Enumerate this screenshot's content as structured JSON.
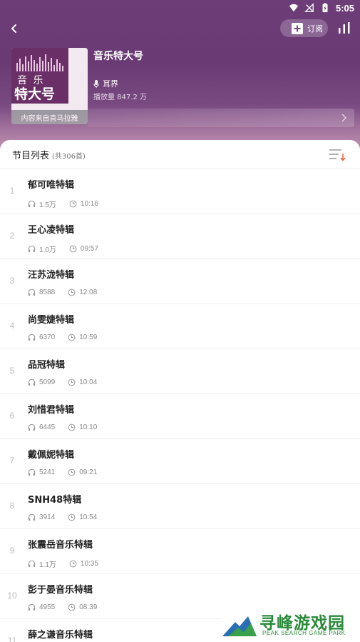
{
  "status_bar": {
    "time": "5:05"
  },
  "header": {
    "subscribe_label": "订阅",
    "cover_line1": "音 乐",
    "cover_line2": "特大号",
    "cover_caption": "内容来自喜马拉雅",
    "album_title": "音乐特大号",
    "host": "耳界",
    "play_count": "播放量 847.2 万"
  },
  "list": {
    "title": "节目列表",
    "count": "(共306首)",
    "tracks": [
      {
        "index": "1",
        "title": "郁可唯特辑",
        "plays": "1.5万",
        "duration": "10:16"
      },
      {
        "index": "2",
        "title": "王心凌特辑",
        "plays": "1.0万",
        "duration": "09:57"
      },
      {
        "index": "3",
        "title": "汪苏泷特辑",
        "plays": "8588",
        "duration": "12:08"
      },
      {
        "index": "4",
        "title": "尚雯婕特辑",
        "plays": "6370",
        "duration": "10:59"
      },
      {
        "index": "5",
        "title": "品冠特辑",
        "plays": "5099",
        "duration": "10:04"
      },
      {
        "index": "6",
        "title": "刘惜君特辑",
        "plays": "6445",
        "duration": "10:10"
      },
      {
        "index": "7",
        "title": "戴佩妮特辑",
        "plays": "5241",
        "duration": "09:21"
      },
      {
        "index": "8",
        "title": "SNH48特辑",
        "plays": "3914",
        "duration": "10:54"
      },
      {
        "index": "9",
        "title": "张震岳音乐特辑",
        "plays": "1.1万",
        "duration": "10:35"
      },
      {
        "index": "10",
        "title": "彭于晏音乐特辑",
        "plays": "4955",
        "duration": "08:39"
      },
      {
        "index": "11",
        "title": "薛之谦音乐特辑",
        "plays": "",
        "duration": ""
      }
    ]
  },
  "watermark": {
    "text": "寻峰游戏园",
    "sub": "PEAK SEARCH GAME PARK"
  },
  "colors": {
    "header_bg": "#6d3d78",
    "watermark_green": "#2a8a3a",
    "sort_accent": "#e8603a"
  },
  "icons": {
    "back": "chevron-left-icon",
    "subscribe": "add-box-icon",
    "stats": "bar-chart-icon",
    "host": "microphone-icon",
    "sort": "sort-list-icon",
    "plays": "headphones-icon",
    "duration": "clock-icon"
  }
}
